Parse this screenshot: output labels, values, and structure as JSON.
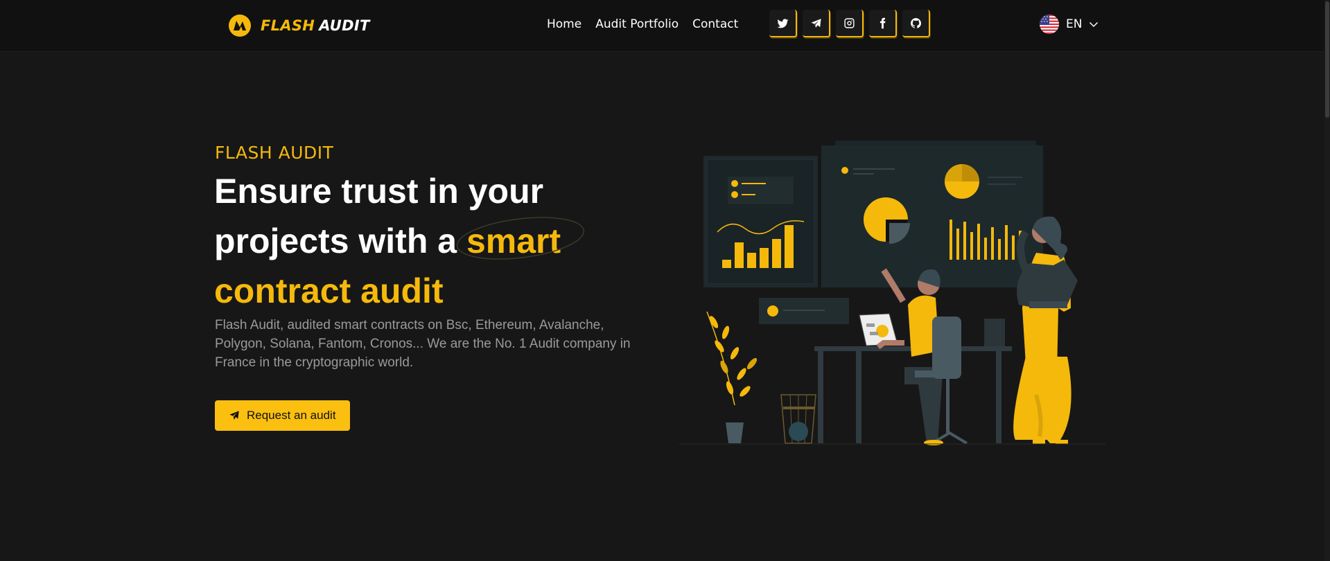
{
  "nav": {
    "brand_primary": "FLASH",
    "brand_secondary": "AUDIT",
    "links": [
      "Home",
      "Audit Portfolio",
      "Contact"
    ],
    "socials": [
      "twitter-icon",
      "telegram-icon",
      "instagram-icon",
      "facebook-icon",
      "github-icon"
    ],
    "language": "EN"
  },
  "hero": {
    "kicker": "FLASH AUDIT",
    "title_part1": "Ensure trust in your projects with a ",
    "title_highlight1": "smart",
    "title_highlight2": "contract audit",
    "description": "Flash Audit, audited smart contracts on Bsc, Ethereum, Avalanche, Polygon, Solana, Fantom, Cronos... We are the No. 1 Audit company in France in the cryptographic world.",
    "cta_label": "Request an audit"
  },
  "colors": {
    "accent": "#f5b90c",
    "background": "#171717",
    "navbar": "#111111"
  }
}
